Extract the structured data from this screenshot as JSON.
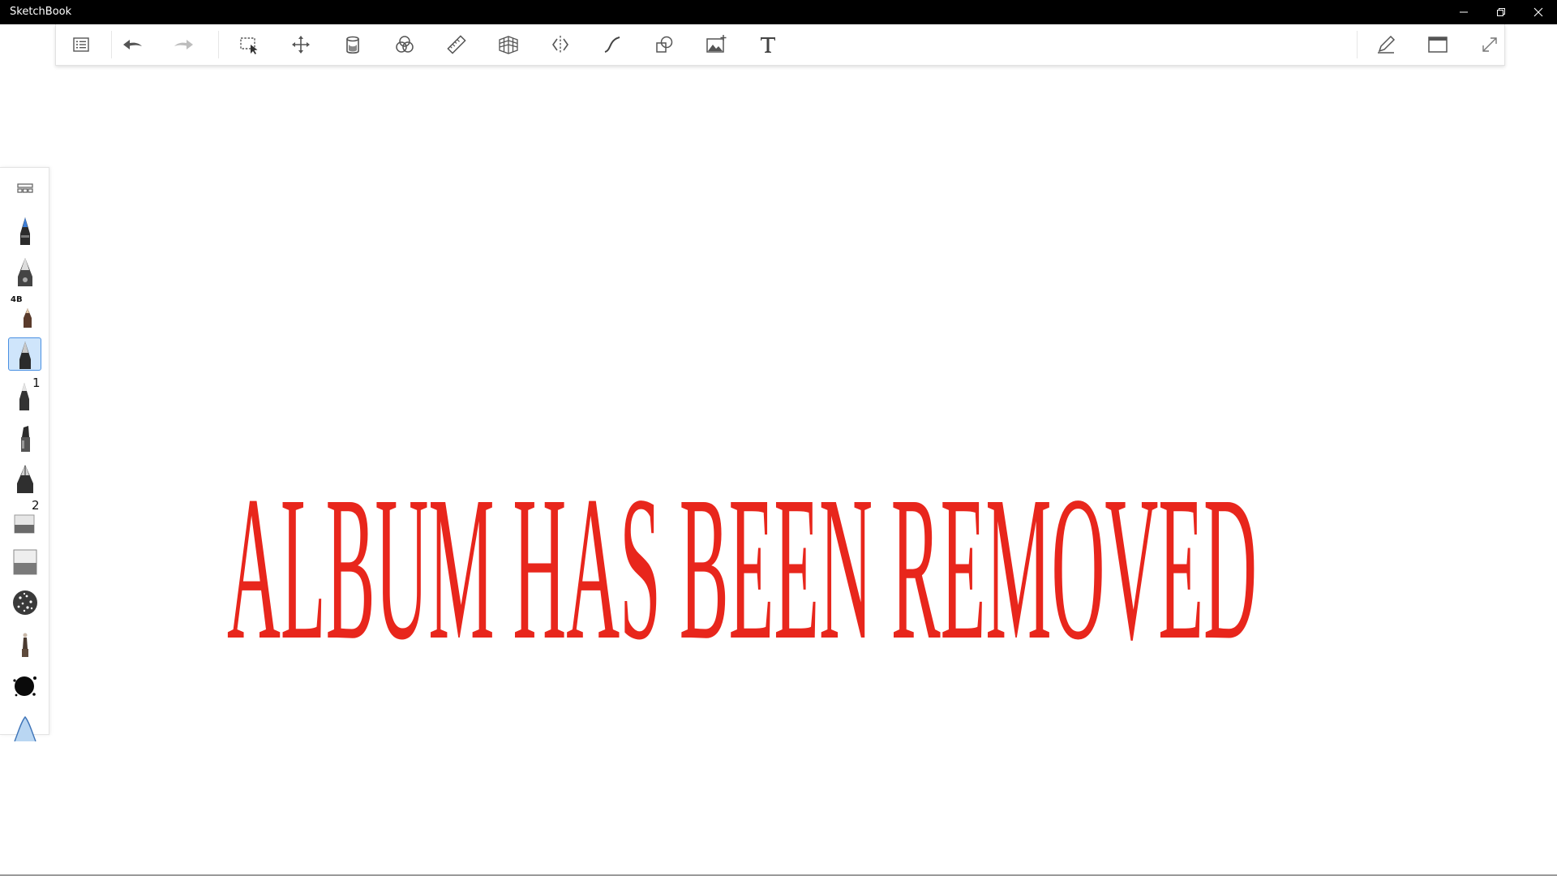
{
  "app": {
    "title": "SketchBook"
  },
  "window_controls": [
    {
      "name": "minimize",
      "icon": "minimize-icon"
    },
    {
      "name": "restore",
      "icon": "restore-icon"
    },
    {
      "name": "close",
      "icon": "close-icon"
    }
  ],
  "toolbar": {
    "left_tools": [
      {
        "name": "gallery-list",
        "icon": "list-icon"
      },
      {
        "name": "undo",
        "icon": "undo-arrow-icon"
      },
      {
        "name": "redo",
        "icon": "redo-arrow-icon"
      }
    ],
    "center_tools": [
      {
        "name": "select",
        "icon": "selection-icon"
      },
      {
        "name": "transform",
        "icon": "move-arrows-icon"
      },
      {
        "name": "fill",
        "icon": "fill-bucket-icon"
      },
      {
        "name": "color-editor",
        "icon": "color-circles-icon"
      },
      {
        "name": "ruler",
        "icon": "ruler-icon"
      },
      {
        "name": "perspective",
        "icon": "perspective-grid-icon"
      },
      {
        "name": "symmetry",
        "icon": "symmetry-icon"
      },
      {
        "name": "stroke",
        "icon": "curve-stroke-icon"
      },
      {
        "name": "shapes",
        "icon": "shapes-icon"
      },
      {
        "name": "add-image",
        "icon": "add-image-icon"
      },
      {
        "name": "text",
        "icon": "text-icon"
      }
    ],
    "right_tools": [
      {
        "name": "brush-properties",
        "icon": "pen-icon"
      },
      {
        "name": "window-layout",
        "icon": "window-icon"
      },
      {
        "name": "fullscreen",
        "icon": "expand-icon"
      }
    ]
  },
  "brush_palette": {
    "header_icon": "palette-menu-icon",
    "brushes": [
      {
        "name": "ballpoint-pen",
        "icon": "ballpoint-pen-icon",
        "badge": ""
      },
      {
        "name": "ink-pen",
        "icon": "ink-pen-icon",
        "badge": ""
      },
      {
        "name": "pencil-4b",
        "icon": "pencil-icon",
        "badge": "4B"
      },
      {
        "name": "technical-pen",
        "icon": "technical-pen-icon",
        "badge": "",
        "selected": true
      },
      {
        "name": "fineliner-1",
        "icon": "fineliner-icon",
        "badge": "1"
      },
      {
        "name": "marker",
        "icon": "marker-icon",
        "badge": ""
      },
      {
        "name": "fountain-pen",
        "icon": "fountain-pen-icon",
        "badge": ""
      },
      {
        "name": "eraser-2",
        "icon": "eraser-icon",
        "badge": "2"
      },
      {
        "name": "hard-eraser",
        "icon": "hard-eraser-icon",
        "badge": ""
      },
      {
        "name": "texture-brush",
        "icon": "texture-brush-icon",
        "badge": ""
      },
      {
        "name": "airbrush",
        "icon": "airbrush-icon",
        "badge": ""
      },
      {
        "name": "ink-splatter",
        "icon": "splatter-icon",
        "badge": ""
      },
      {
        "name": "soft-brush",
        "icon": "soft-brush-icon",
        "badge": ""
      }
    ]
  },
  "canvas": {
    "text": "ALBUM HAS BEEN REMOVED",
    "text_color": "#e8261c"
  },
  "colors": {
    "titlebar": "#000000",
    "accent": "#4a90e2",
    "selected_bg": "#cfe5fb"
  }
}
